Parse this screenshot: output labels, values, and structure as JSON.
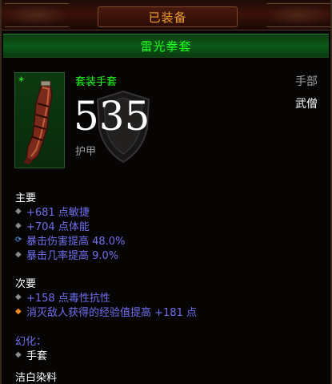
{
  "header": {
    "equipped_label": "已装备"
  },
  "item": {
    "name": "雷光拳套",
    "type": "套装手套",
    "slot": "手部",
    "class": "武僧",
    "armor": "535",
    "armor_label": "护甲",
    "set_marker": "*"
  },
  "primary": {
    "title": "主要",
    "stats": [
      {
        "text": "+681 点敏捷",
        "bullet": "diamond-grey"
      },
      {
        "text": "+704 点体能",
        "bullet": "diamond-grey"
      },
      {
        "text": "暴击伤害提高 48.0%",
        "bullet": "reroll-blue"
      },
      {
        "text": "暴击几率提高 9.0%",
        "bullet": "diamond-grey"
      }
    ]
  },
  "secondary": {
    "title": "次要",
    "stats": [
      {
        "text": "+158 点毒性抗性",
        "bullet": "diamond-grey"
      },
      {
        "text": "消灭敌人获得的经验值提高 +181 点",
        "bullet": "diamond-orange"
      }
    ]
  },
  "transmog": {
    "title": "幻化：",
    "value": "手套"
  },
  "dye": {
    "label": "洁白染料"
  },
  "colors": {
    "set_green": "#1eff1e",
    "magic_blue": "#6f6ff0",
    "equipped_orange": "#f0a030",
    "label_grey": "#a0a0a0"
  },
  "icons": [
    "diamond-bullet-icon",
    "reroll-icon",
    "gauntlet-icon",
    "shield-icon"
  ]
}
